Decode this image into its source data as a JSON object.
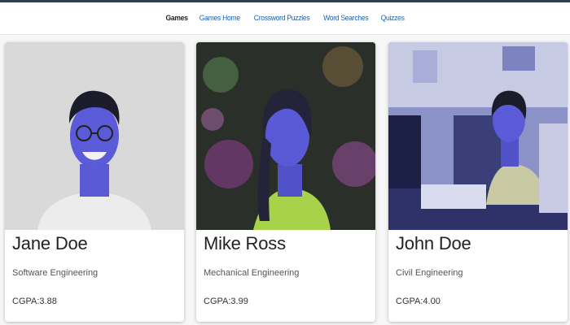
{
  "nav": {
    "brand": "Games",
    "links": [
      "Games Home",
      "Crossword Puzzles",
      "Word Searches",
      "Quizzes"
    ]
  },
  "cards": [
    {
      "name": "Jane Doe",
      "department": "Software Engineering",
      "gpa": "CGPA:3.88"
    },
    {
      "name": "Mike Ross",
      "department": "Mechanical Engineering",
      "gpa": "CGPA:3.99"
    },
    {
      "name": "John Doe",
      "department": "Civil Engineering",
      "gpa": "CGPA:4.00"
    }
  ]
}
